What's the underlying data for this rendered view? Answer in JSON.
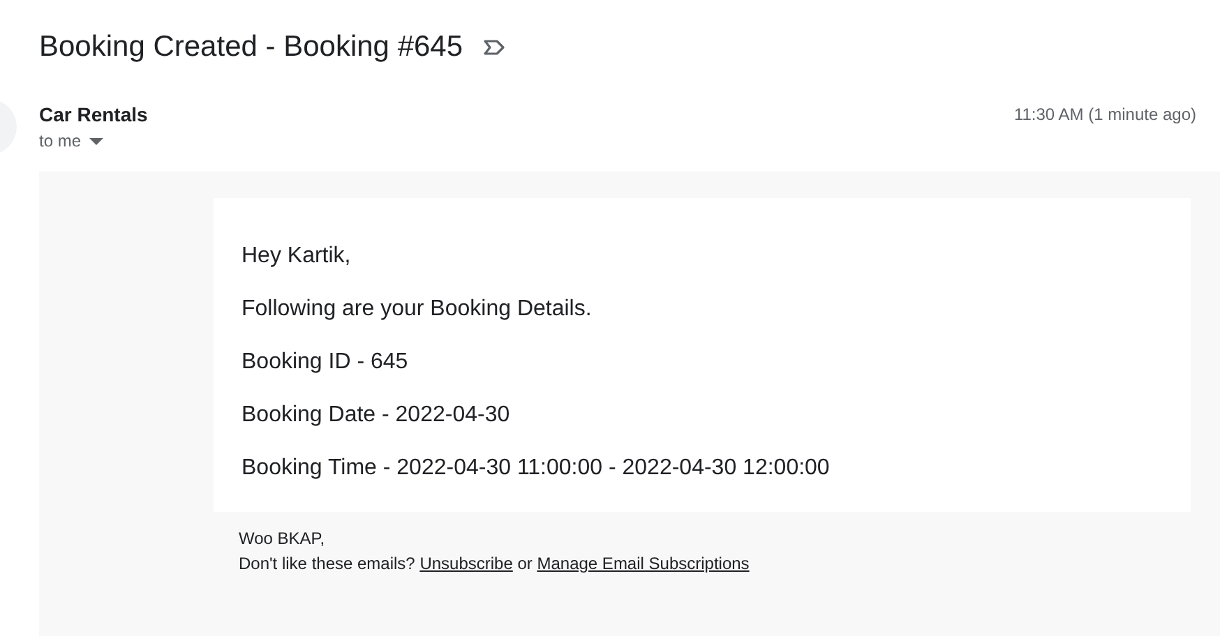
{
  "subject": "Booking Created - Booking #645",
  "sender": {
    "name": "Car Rentals",
    "recipient": "to me",
    "time": "11:30 AM (1 minute ago)"
  },
  "body": {
    "lines": [
      "Hey Kartik,",
      "Following are your Booking Details.",
      "Booking ID - 645",
      "Booking Date - 2022-04-30",
      "Booking Time - 2022-04-30 11:00:00 - 2022-04-30 12:00:00"
    ]
  },
  "footer": {
    "signoff": "Woo BKAP,",
    "prompt": "Don't like these emails?",
    "unsubscribe": "Unsubscribe",
    "connector": "or",
    "manage": "Manage Email Subscriptions"
  }
}
